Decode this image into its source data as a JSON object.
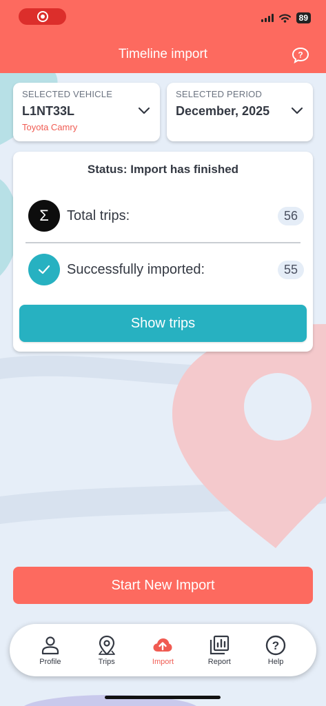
{
  "status_bar": {
    "battery": "89"
  },
  "header": {
    "title": "Timeline import"
  },
  "vehicle": {
    "label": "SELECTED VEHICLE",
    "plate": "L1NT33L",
    "model": "Toyota Camry"
  },
  "period": {
    "label": "SELECTED PERIOD",
    "value": "December, 2025"
  },
  "status": {
    "title": "Status: Import has finished",
    "total_label": "Total trips:",
    "total_count": "56",
    "success_label": "Successfully imported:",
    "success_count": "55",
    "show_trips": "Show trips"
  },
  "start_import": "Start New Import",
  "nav": {
    "items": [
      {
        "label": "Profile",
        "icon": "person-icon"
      },
      {
        "label": "Trips",
        "icon": "map-pin-icon"
      },
      {
        "label": "Import",
        "icon": "cloud-upload-icon",
        "active": true
      },
      {
        "label": "Report",
        "icon": "report-chart-icon"
      },
      {
        "label": "Help",
        "icon": "help-icon"
      }
    ]
  },
  "colors": {
    "accent": "#fd6a5f",
    "teal": "#27b1c1",
    "text": "#333842",
    "background": "#e6eef8"
  }
}
